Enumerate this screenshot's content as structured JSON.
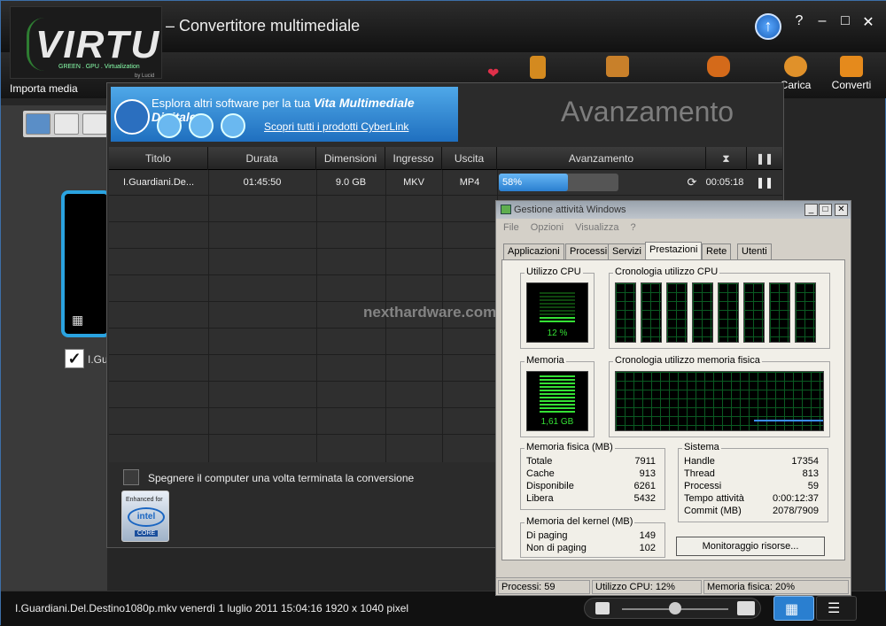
{
  "window": {
    "title": "– Convertitore multimediale",
    "controls": [
      "?",
      "–",
      "□",
      "✕"
    ],
    "logo": {
      "name": "VIRTU",
      "tagline": "GREEN . GPU . Virtualization",
      "by": "by Lucid"
    }
  },
  "toolbar": {
    "import_label": "Importa media",
    "upload_label": "Carica",
    "convert_label": "Converti"
  },
  "left": {
    "item_label": "I.Gu"
  },
  "dialog": {
    "title": "Avanzamento",
    "banner": {
      "line1_prefix": "Esplora altri software per la tua ",
      "line1_bold": "Vita Multimediale Digitale",
      "link": "Scopri tutti i prodotti CyberLink"
    },
    "columns": [
      "Titolo",
      "Durata",
      "Dimensioni",
      "Ingresso",
      "Uscita",
      "Avanzamento",
      "⧗"
    ],
    "rows": [
      {
        "title": "I.Guardiani.De...",
        "duration": "01:45:50",
        "size": "9.0 GB",
        "input": "MKV",
        "output": "MP4",
        "progress_label": "58%",
        "progress": 0.58,
        "time_left": "00:05:18"
      }
    ],
    "shutdown_label": "Spegnere il computer una volta terminata la conversione",
    "intel_badge": {
      "top": "Enhanced for",
      "logo": "intel",
      "bottom": "CORE"
    }
  },
  "status_bar": {
    "file_info": "I.Guardiani.Del.Destino1080p.mkv  venerdì 1 luglio 2011 15:04:16  1920 x 1040 pixel"
  },
  "task_manager": {
    "title": "Gestione attività Windows",
    "menu": [
      "File",
      "Opzioni",
      "Visualizza",
      "?"
    ],
    "tabs": [
      "Applicazioni",
      "Processi",
      "Servizi",
      "Prestazioni",
      "Rete",
      "Utenti"
    ],
    "selected_tab": "Prestazioni",
    "cpu_usage_label": "Utilizzo CPU",
    "cpu_usage_value": "12 %",
    "cpu_history_label": "Cronologia utilizzo CPU",
    "memory_label": "Memoria",
    "memory_value": "1,61 GB",
    "memory_history_label": "Cronologia utilizzo memoria fisica",
    "physical_memory": {
      "label": "Memoria fisica (MB)",
      "rows": [
        {
          "k": "Totale",
          "v": "7911"
        },
        {
          "k": "Cache",
          "v": "913"
        },
        {
          "k": "Disponibile",
          "v": "6261"
        },
        {
          "k": "Libera",
          "v": "5432"
        }
      ]
    },
    "kernel_memory": {
      "label": "Memoria del kernel (MB)",
      "rows": [
        {
          "k": "Di paging",
          "v": "149"
        },
        {
          "k": "Non di paging",
          "v": "102"
        }
      ]
    },
    "system": {
      "label": "Sistema",
      "rows": [
        {
          "k": "Handle",
          "v": "17354"
        },
        {
          "k": "Thread",
          "v": "813"
        },
        {
          "k": "Processi",
          "v": "59"
        },
        {
          "k": "Tempo attività",
          "v": "0:00:12:37"
        },
        {
          "k": "Commit (MB)",
          "v": "2078/7909"
        }
      ]
    },
    "resource_monitor_button": "Monitoraggio risorse...",
    "status": {
      "processes": "Processi: 59",
      "cpu": "Utilizzo CPU: 12%",
      "memory": "Memoria fisica: 20%"
    }
  },
  "watermark": "nexthardware.com"
}
